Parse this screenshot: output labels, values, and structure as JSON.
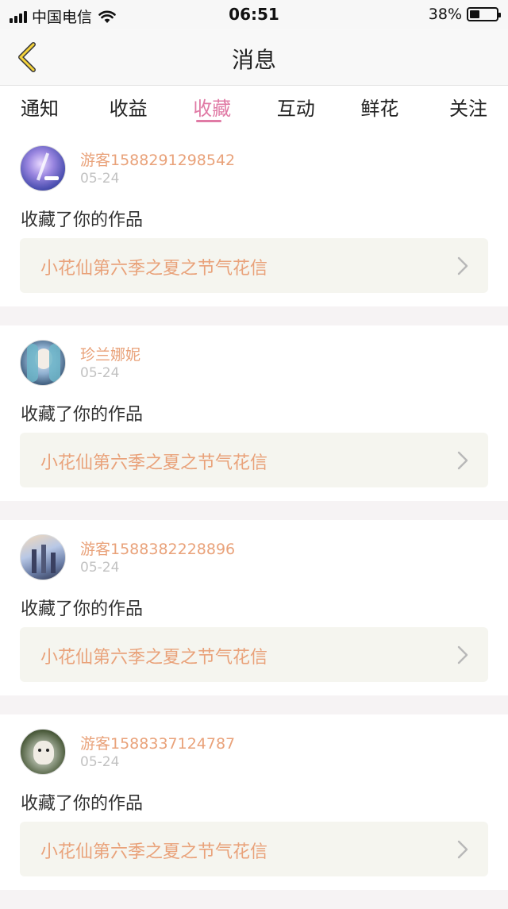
{
  "status_bar": {
    "carrier": "中国电信",
    "time": "06:51",
    "battery_percent": "38%",
    "battery_level": 0.38,
    "icons": [
      "signal-icon",
      "wifi-icon",
      "battery-icon"
    ]
  },
  "nav": {
    "title": "消息",
    "back_icon": "chevron-left-icon"
  },
  "tabs": [
    {
      "label": "通知",
      "active": false
    },
    {
      "label": "收益",
      "active": false
    },
    {
      "label": "收藏",
      "active": true
    },
    {
      "label": "互动",
      "active": false
    },
    {
      "label": "鲜花",
      "active": false
    },
    {
      "label": "关注",
      "active": false
    }
  ],
  "colors": {
    "accent_pink": "#e07aa5",
    "username_orange": "#e9a27a",
    "link_bg": "#f5f5ef"
  },
  "items": [
    {
      "username": "游客1588291298542",
      "date": "05-24",
      "action": "收藏了你的作品",
      "work_title": "小花仙第六季之夏之节气花信"
    },
    {
      "username": "珍兰娜妮",
      "date": "05-24",
      "action": "收藏了你的作品",
      "work_title": "小花仙第六季之夏之节气花信"
    },
    {
      "username": "游客1588382228896",
      "date": "05-24",
      "action": "收藏了你的作品",
      "work_title": "小花仙第六季之夏之节气花信"
    },
    {
      "username": "游客1588337124787",
      "date": "05-24",
      "action": "收藏了你的作品",
      "work_title": "小花仙第六季之夏之节气花信"
    }
  ]
}
